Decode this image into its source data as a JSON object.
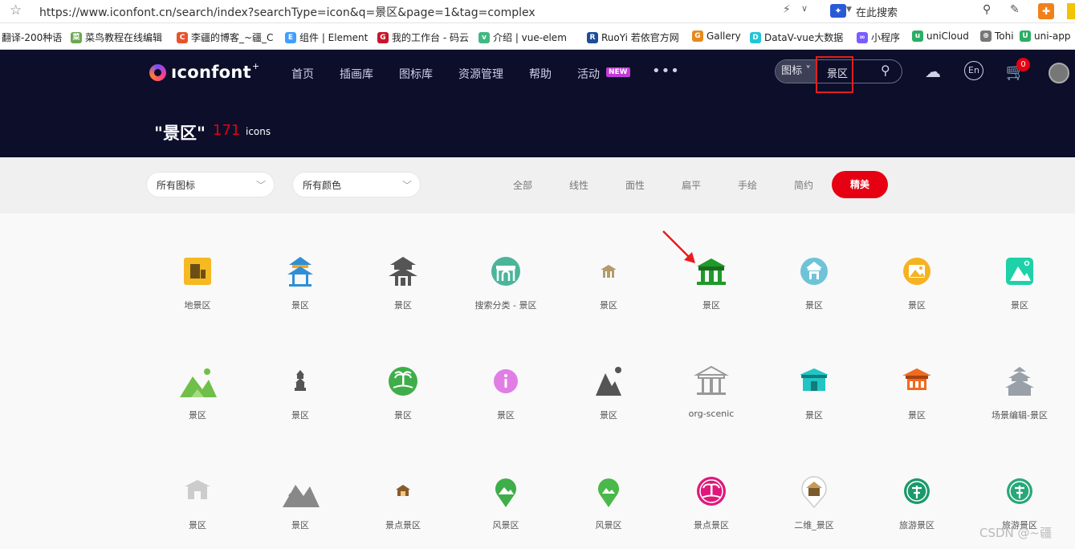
{
  "browser": {
    "url": "https://www.iconfont.cn/search/index?searchType=icon&q=景区&page=1&tag=complex",
    "search_label": "在此搜索",
    "bookmarks": [
      {
        "label": "翻译-200种语",
        "color": "#5ab0e8",
        "glyph": ""
      },
      {
        "label": "菜鸟教程在线编辑",
        "color": "#6aa84f",
        "glyph": "菜"
      },
      {
        "label": "李疆的博客_~疆_C",
        "color": "#e8532b",
        "glyph": "C"
      },
      {
        "label": "组件 | Element",
        "color": "#409eff",
        "glyph": "E"
      },
      {
        "label": "我的工作台 - 码云",
        "color": "#c7162b",
        "glyph": "G"
      },
      {
        "label": "介绍 | vue-elem",
        "color": "#42b883",
        "glyph": "v"
      },
      {
        "label": "RuoYi 若依官方网",
        "color": "#1e4d99",
        "glyph": "R"
      },
      {
        "label": "Gallery",
        "color": "#e58a1f",
        "glyph": "G"
      },
      {
        "label": "DataV-vue大数据",
        "color": "#1ec6d8",
        "glyph": "D"
      },
      {
        "label": "小程序",
        "color": "#7a5cff",
        "glyph": "∞"
      },
      {
        "label": "uniCloud",
        "color": "#2bae66",
        "glyph": "u"
      },
      {
        "label": "Tohi",
        "color": "#777777",
        "glyph": "⊕"
      },
      {
        "label": "uni-app",
        "color": "#2bae66",
        "glyph": "U"
      }
    ]
  },
  "nav": {
    "logo_text": "ıconfont",
    "logo_sup": "+",
    "menu": [
      "首页",
      "插画库",
      "图标库",
      "资源管理",
      "帮助",
      "活动"
    ],
    "new_badge": "NEW",
    "more": "•••",
    "search_type": "图标",
    "search_query": "景区",
    "cart_count": "0",
    "lang": "En"
  },
  "result": {
    "title": "\"景区\"",
    "count": "171",
    "unit": "icons"
  },
  "filters": {
    "dropdowns": [
      "所有图标",
      "所有颜色"
    ],
    "tags": [
      "全部",
      "线性",
      "面性",
      "扁平",
      "手绘",
      "简约",
      "精美"
    ],
    "active_tag": "精美"
  },
  "icons": [
    {
      "label": "地景区",
      "icon": "building-icon",
      "color": "#f5b921"
    },
    {
      "label": "景区",
      "icon": "pavilion-icon",
      "color": "#2e8fd6"
    },
    {
      "label": "景区",
      "icon": "pagoda-icon",
      "color": "#555555"
    },
    {
      "label": "搜索分类 - 景区",
      "icon": "gate-circle-icon",
      "color": "#4bb59a"
    },
    {
      "label": "景区",
      "icon": "temple-small-icon",
      "color": "#b59a6c"
    },
    {
      "label": "景区",
      "icon": "temple-icon",
      "color": "#1f9a2a"
    },
    {
      "label": "景区",
      "icon": "pavilion-circle-icon",
      "color": "#6fc3d8"
    },
    {
      "label": "景区",
      "icon": "picture-circle-icon",
      "color": "#f6b321"
    },
    {
      "label": "景区",
      "icon": "mountain-square-icon",
      "color": "#1ed1a8"
    },
    {
      "label": "景区",
      "icon": "mountains-icon",
      "color": "#6fbf4a"
    },
    {
      "label": "景区",
      "icon": "tower-icon",
      "color": "#555555"
    },
    {
      "label": "景区",
      "icon": "palm-circle-icon",
      "color": "#3fae4a"
    },
    {
      "label": "景区",
      "icon": "info-circle-icon",
      "color": "#e07ee6"
    },
    {
      "label": "景区",
      "icon": "mountain-sun-icon",
      "color": "#555555"
    },
    {
      "label": "org-scenic",
      "icon": "classic-building-icon",
      "color": "#999999"
    },
    {
      "label": "景区",
      "icon": "teal-temple-icon",
      "color": "#22c4c4"
    },
    {
      "label": "景区",
      "icon": "orange-temple-icon",
      "color": "#f06b1e"
    },
    {
      "label": "场景编辑-景区",
      "icon": "grey-pagoda-icon",
      "color": "#9aa0a8"
    },
    {
      "label": "景区",
      "icon": "light-temple-icon",
      "color": "#cccccc"
    },
    {
      "label": "景区",
      "icon": "grey-mountains-icon",
      "color": "#888888"
    },
    {
      "label": "景点景区",
      "icon": "brown-temple-icon",
      "color": "#8b5a2b"
    },
    {
      "label": "风景区",
      "icon": "map-pin-icon",
      "color": "#3fae4a"
    },
    {
      "label": "风景区",
      "icon": "map-pin-2-icon",
      "color": "#4ab84a"
    },
    {
      "label": "景点景区",
      "icon": "palm-ring-icon",
      "color": "#e0187a"
    },
    {
      "label": "二维_景区",
      "icon": "pin-temple-icon",
      "color": "#c89a5a"
    },
    {
      "label": "旅游景区",
      "icon": "tree-circle-icon",
      "color": "#1a9a6a"
    },
    {
      "label": "旅游景区",
      "icon": "tree-circle-2-icon",
      "color": "#27a878"
    }
  ],
  "watermark": "CSDN @~疆"
}
